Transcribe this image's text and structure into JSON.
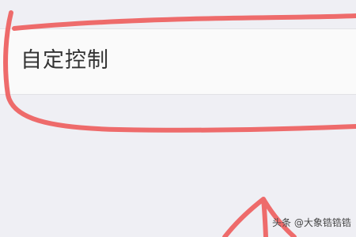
{
  "settings_row": {
    "label": "自定控制"
  },
  "watermark": {
    "text": "头条 @大象锆锆锆"
  },
  "annotation": {
    "color": "#ee6b6b"
  }
}
